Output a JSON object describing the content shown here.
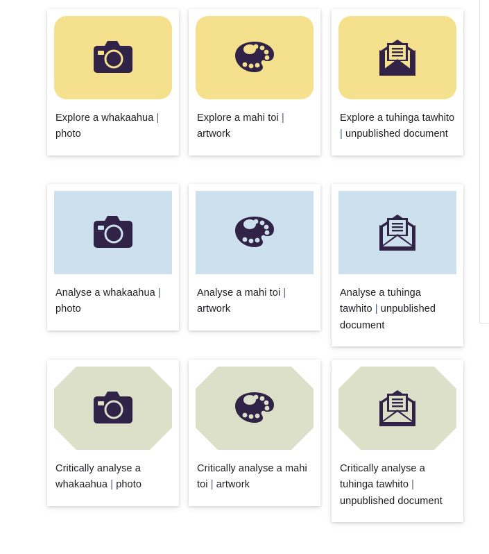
{
  "page": {
    "type": "resource-card-grid",
    "background_color": "#ffffff",
    "separator": "|"
  },
  "theme": {
    "icon_color": "#312247",
    "yellow": "#F5E08D",
    "blue": "#CDE0EE",
    "green": "#DDE0C8",
    "card_background": "#FFFFFF",
    "text_color": "#1C1C22",
    "separator_color": "#46607E"
  },
  "rows": [
    {
      "name": "explore",
      "shape": "rounded-rectangle",
      "color": "#F5E08D",
      "cards": [
        {
          "icon": "camera-icon",
          "prefix": "Explore a whakaahua ",
          "separator": "|",
          "suffix": " photo",
          "text": "Explore a whakaahua | photo"
        },
        {
          "icon": "palette-icon",
          "prefix": "Explore a mahi toi ",
          "separator": "|",
          "suffix": " artwork",
          "text": "Explore a mahi toi | artwork"
        },
        {
          "icon": "open-envelope-document-icon",
          "prefix": "Explore a tuhinga tawhito ",
          "separator": "|",
          "suffix": " unpublished document",
          "text": "Explore a tuhinga tawhito | unpublished document"
        }
      ]
    },
    {
      "name": "analyse",
      "shape": "square",
      "color": "#CDE0EE",
      "cards": [
        {
          "icon": "camera-icon",
          "prefix": "Analyse a whakaahua ",
          "separator": "|",
          "suffix": " photo",
          "text": "Analyse a whakaahua | photo"
        },
        {
          "icon": "palette-icon",
          "prefix": "Analyse a mahi toi ",
          "separator": "|",
          "suffix": " artwork",
          "text": "Analyse a mahi toi | artwork"
        },
        {
          "icon": "open-envelope-document-icon",
          "prefix": "Analyse a tuhinga tawhito ",
          "separator": "|",
          "suffix": " unpublished document",
          "text": "Analyse a tuhinga tawhito | unpublished document"
        }
      ]
    },
    {
      "name": "critically-analyse",
      "shape": "octagon",
      "color": "#DDE0C8",
      "cards": [
        {
          "icon": "camera-icon",
          "prefix": "Critically analyse a whakaahua ",
          "separator": "|",
          "suffix": " photo",
          "text": "Critically analyse a whakaahua | photo"
        },
        {
          "icon": "palette-icon",
          "prefix": "Critically analyse a mahi toi ",
          "separator": "|",
          "suffix": " artwork",
          "text": "Critically analyse a mahi toi | artwork"
        },
        {
          "icon": "open-envelope-document-icon",
          "prefix": "Critically analyse a tuhinga tawhito ",
          "separator": "|",
          "suffix": " unpublished document",
          "text": "Critically analyse a tuhinga tawhito | unpublished document"
        }
      ]
    }
  ]
}
